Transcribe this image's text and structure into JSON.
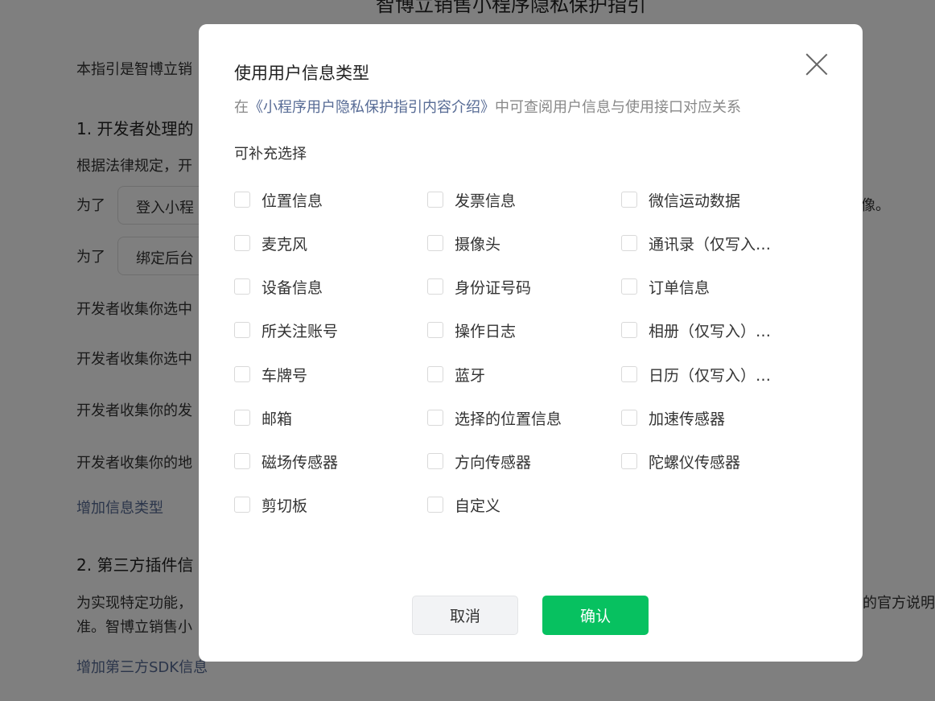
{
  "background": {
    "page_title": "智博立销售小程序隐私保护指引",
    "intro": "本指引是智博立销",
    "section1_heading": "1. 开发者处理的",
    "section1_text": "根据法律规定，开",
    "purpose_prefix_1": "为了",
    "purpose_pill_1": "登入小程",
    "purpose_suffix_1": "像。",
    "purpose_prefix_2": "为了",
    "purpose_pill_2": "绑定后台",
    "collect_1": "开发者收集你选中",
    "collect_2": "开发者收集你选中",
    "collect_3": "开发者收集你的发",
    "collect_4": "开发者收集你的地",
    "add_info_type_link": "增加信息类型",
    "section2_heading": "2. 第三方插件信",
    "section2_text_1": "为实现特定功能，",
    "section2_text_1_right": "的官方说明",
    "section2_text_2": "准。智博立销售小",
    "add_sdk_link": "增加第三方SDK信息"
  },
  "dialog": {
    "title": "使用用户信息类型",
    "desc_prefix": "在",
    "desc_link": "《小程序用户隐私保护指引内容介绍》",
    "desc_suffix": "中可查阅用户信息与使用接口对应关系",
    "section_label": "可补充选择",
    "options": [
      "位置信息",
      "发票信息",
      "微信运动数据",
      "麦克风",
      "摄像头",
      "通讯录（仅写入）权限",
      "设备信息",
      "身份证号码",
      "订单信息",
      "所关注账号",
      "操作日志",
      "相册（仅写入）权限",
      "车牌号",
      "蓝牙",
      "日历（仅写入）权限",
      "邮箱",
      "选择的位置信息",
      "加速传感器",
      "磁场传感器",
      "方向传感器",
      "陀螺仪传感器",
      "剪切板",
      "自定义"
    ],
    "cancel_label": "取消",
    "confirm_label": "确认"
  },
  "colors": {
    "confirm_green": "#07c160",
    "link_blue": "#576b95",
    "overlay": "rgba(0,0,0,0.5)"
  }
}
